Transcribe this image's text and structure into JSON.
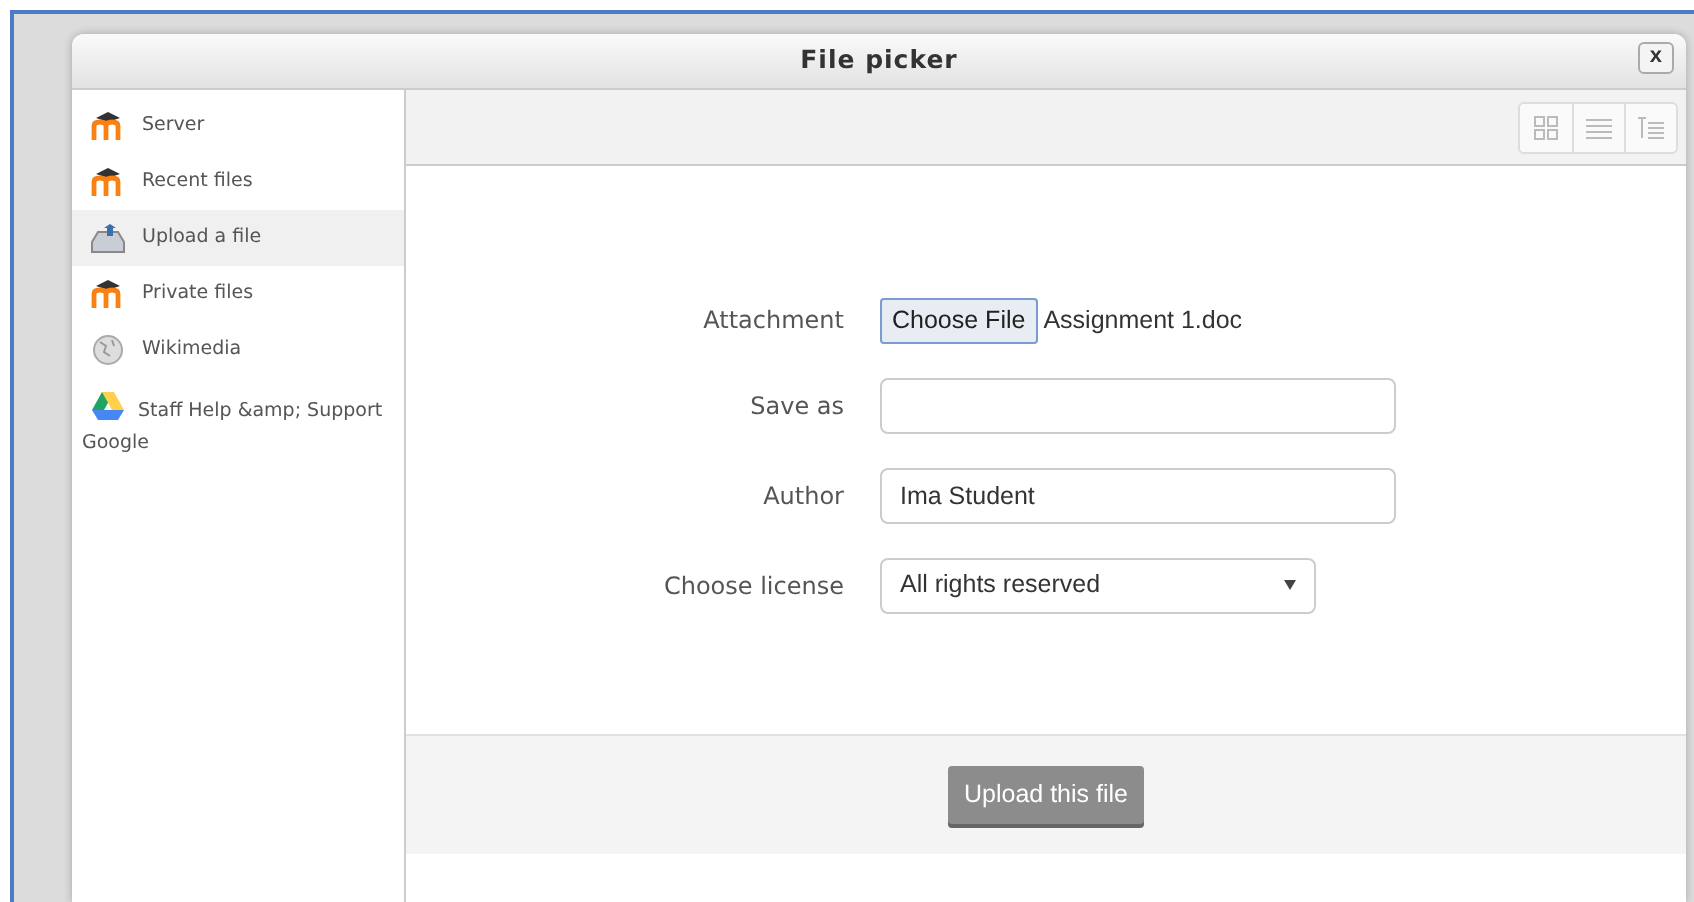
{
  "dialog": {
    "title": "File picker",
    "close": "x"
  },
  "sidebar": {
    "items": [
      {
        "label": "Server",
        "kind": "moodle",
        "selected": false
      },
      {
        "label": "Recent files",
        "kind": "moodle",
        "selected": false
      },
      {
        "label": "Upload a file",
        "kind": "upload",
        "selected": true
      },
      {
        "label": "Private files",
        "kind": "moodle",
        "selected": false
      },
      {
        "label": "Wikimedia",
        "kind": "globe",
        "selected": false
      },
      {
        "label": "Staff Help &amp; Support Google",
        "kind": "drive",
        "selected": false
      }
    ]
  },
  "form": {
    "attachment": {
      "label": "Attachment",
      "button": "Choose File",
      "filename": "Assignment 1.doc"
    },
    "save_as": {
      "label": "Save as"
    },
    "author": {
      "label": "Author",
      "value": "Ima Student"
    },
    "license": {
      "label": "Choose license",
      "value": "All rights reserved"
    },
    "submit": "Upload this file"
  }
}
